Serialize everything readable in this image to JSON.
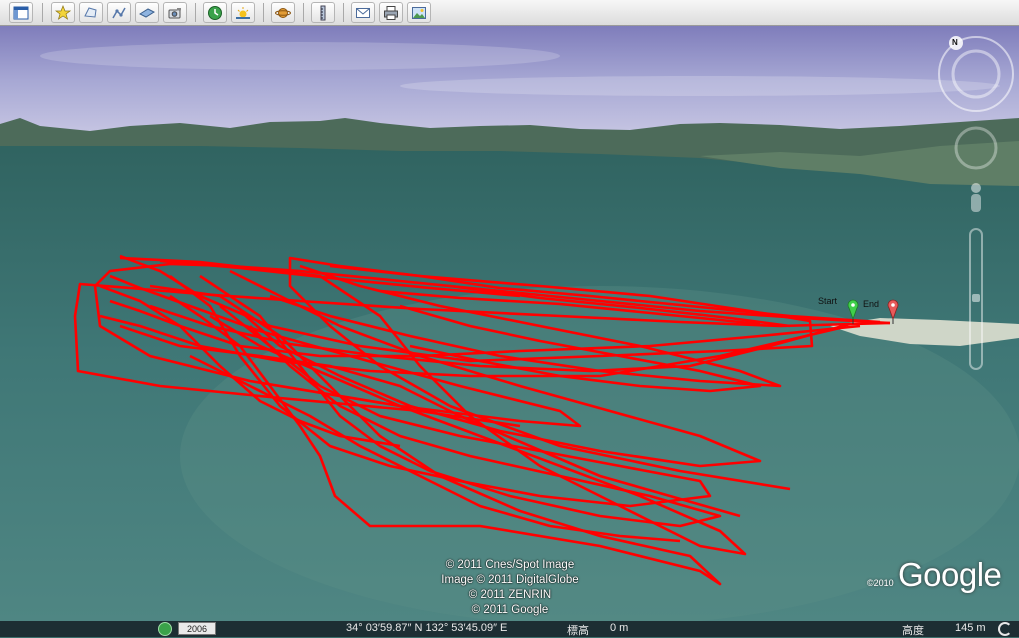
{
  "toolbar": {
    "buttons": [
      {
        "name": "sidebar-toggle-button",
        "icon": "sidebar-icon"
      },
      {
        "name": "add-placemark-button",
        "icon": "pushpin-icon"
      },
      {
        "name": "add-polygon-button",
        "icon": "polygon-icon"
      },
      {
        "name": "add-path-button",
        "icon": "path-icon"
      },
      {
        "name": "add-image-overlay-button",
        "icon": "image-overlay-icon"
      },
      {
        "name": "record-tour-button",
        "icon": "camera-icon"
      },
      {
        "name": "historical-imagery-button",
        "icon": "clock-icon"
      },
      {
        "name": "sunlight-button",
        "icon": "sun-icon"
      },
      {
        "name": "switch-planet-button",
        "icon": "planet-icon"
      },
      {
        "name": "ruler-button",
        "icon": "ruler-icon"
      },
      {
        "name": "email-button",
        "icon": "envelope-icon"
      },
      {
        "name": "print-button",
        "icon": "printer-icon"
      },
      {
        "name": "save-image-button",
        "icon": "photo-icon"
      }
    ]
  },
  "map": {
    "start_label": "Start",
    "end_label": "End",
    "track_color": "#ff0000",
    "start_marker_color": "#3fcf4a",
    "end_marker_color": "#e85a5a",
    "compass_north": "N"
  },
  "copyright": {
    "line1": "© 2011 Cnes/Spot Image",
    "line2": "Image © 2011 DigitalGlobe",
    "line3": "© 2011 ZENRIN",
    "line4": "© 2011 Google"
  },
  "logo": {
    "year": "©2010",
    "text": "Google"
  },
  "status": {
    "imagery_year": "2006",
    "coordinates": "34° 03′59.87″ N 132° 53′45.09″ E",
    "elevation_label": "標高",
    "elevation_value": "0 m",
    "eye_alt_label": "高度",
    "eye_alt_value": "145 m"
  }
}
